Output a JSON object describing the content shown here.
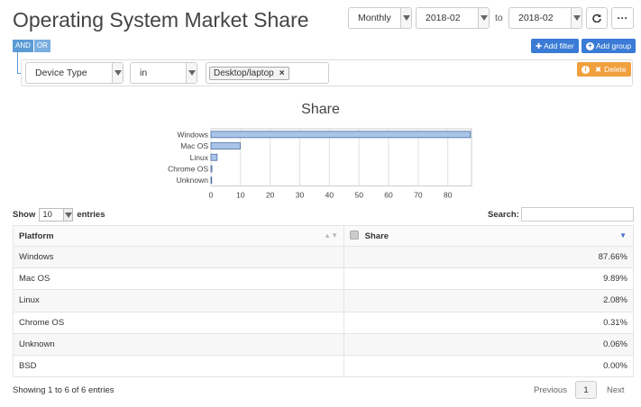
{
  "title": "Operating System Market Share",
  "header": {
    "period": "Monthly",
    "from": "2018-02",
    "to_label": "to",
    "to": "2018-02",
    "refresh_icon": "refresh-icon",
    "more_icon": "more-icon",
    "more_label": "···"
  },
  "logic": {
    "and": "AND",
    "or": "OR"
  },
  "buttons": {
    "add_filter": "Add filter",
    "add_group": "Add group",
    "delete": "Delete"
  },
  "filter": {
    "field": "Device Type",
    "operator": "in",
    "value_tag": "Desktop/laptop",
    "remove_icon": "×"
  },
  "chart_data": {
    "type": "bar",
    "orientation": "horizontal",
    "title": "Share",
    "categories": [
      "Windows",
      "Mac OS",
      "Linux",
      "Chrome OS",
      "Unknown"
    ],
    "values": [
      87.66,
      9.89,
      2.08,
      0.31,
      0.06
    ],
    "xlim": [
      0,
      88
    ],
    "xticks": [
      0,
      10,
      20,
      30,
      40,
      50,
      60,
      70,
      80
    ],
    "bar_color": "#a9c4e8",
    "bar_border": "#4a6fa5",
    "grid": true
  },
  "table_controls": {
    "show": "Show",
    "entries_value": "10",
    "entries": "entries",
    "search": "Search:"
  },
  "table": {
    "columns": [
      "Platform",
      "Share"
    ],
    "rows": [
      [
        "Windows",
        "87.66%"
      ],
      [
        "Mac OS",
        "9.89%"
      ],
      [
        "Linux",
        "2.08%"
      ],
      [
        "Chrome OS",
        "0.31%"
      ],
      [
        "Unknown",
        "0.06%"
      ],
      [
        "BSD",
        "0.00%"
      ]
    ]
  },
  "footer": {
    "info": "Showing 1 to 6 of 6 entries",
    "previous": "Previous",
    "page": "1",
    "next": "Next"
  }
}
